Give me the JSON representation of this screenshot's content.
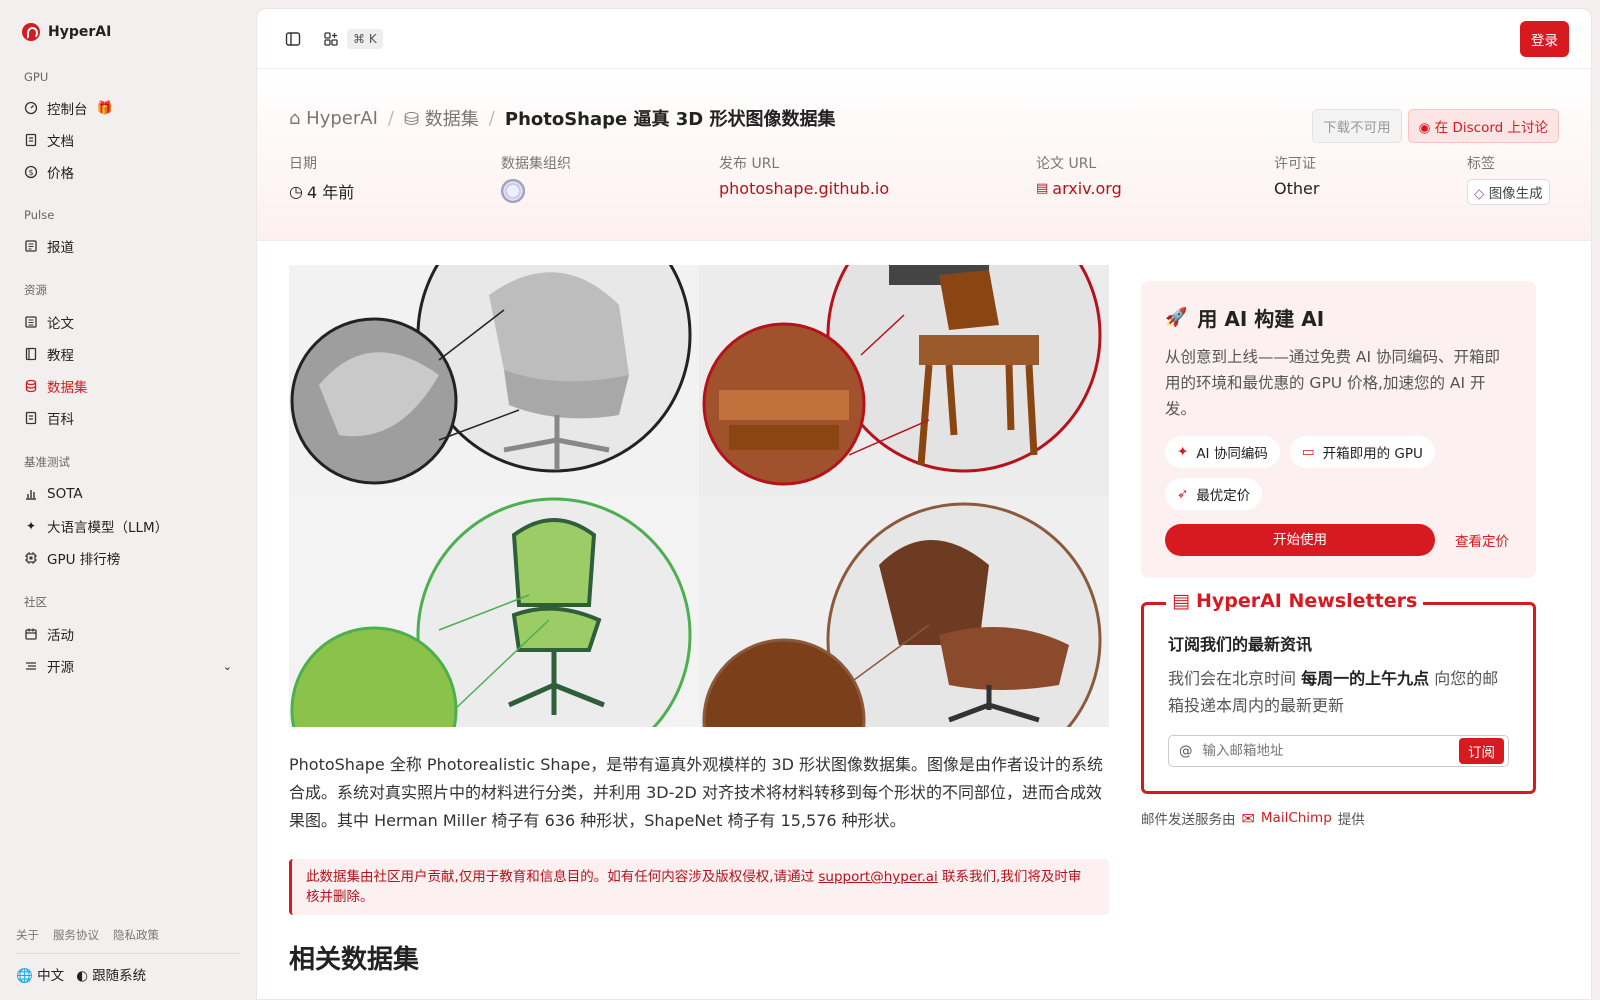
{
  "app": {
    "name": "HyperAI"
  },
  "sidebar": {
    "sections": [
      {
        "label": "GPU",
        "items": [
          {
            "label": "控制台",
            "icon": "dashboard-icon"
          },
          {
            "label": "文档",
            "icon": "doc-icon"
          },
          {
            "label": "价格",
            "icon": "dollar-icon"
          }
        ]
      },
      {
        "label": "Pulse",
        "items": [
          {
            "label": "报道",
            "icon": "news-icon"
          }
        ]
      },
      {
        "label": "资源",
        "items": [
          {
            "label": "论文",
            "icon": "paper-icon"
          },
          {
            "label": "教程",
            "icon": "book-icon"
          },
          {
            "label": "数据集",
            "icon": "database-icon"
          },
          {
            "label": "百科",
            "icon": "wiki-icon"
          }
        ]
      },
      {
        "label": "基准测试",
        "items": [
          {
            "label": "SOTA",
            "icon": "chart-icon"
          },
          {
            "label": "大语言模型（LLM）",
            "icon": "sparkle-icon"
          },
          {
            "label": "GPU 排行榜",
            "icon": "chip-icon"
          }
        ]
      },
      {
        "label": "社区",
        "items": [
          {
            "label": "活动",
            "icon": "calendar-icon"
          },
          {
            "label": "开源",
            "icon": "list-icon"
          }
        ]
      }
    ],
    "footer_links": [
      "关于",
      "服务协议",
      "隐私政策"
    ],
    "language": "中文",
    "theme": "跟随系统"
  },
  "topbar": {
    "shortcut": "⌘ K",
    "login": "登录"
  },
  "hero": {
    "breadcrumb": [
      "HyperAI",
      "数据集",
      "PhotoShape 逼真 3D 形状图像数据集"
    ],
    "download_btn": "下载不可用",
    "discord_btn": "在 Discord 上讨论",
    "meta": [
      {
        "label": "日期",
        "value": "4 年前"
      },
      {
        "label": "数据集组织",
        "value": ""
      },
      {
        "label": "发布 URL",
        "value": "photoshape.github.io"
      },
      {
        "label": "论文 URL",
        "value": "arxiv.org"
      },
      {
        "label": "许可证",
        "value": "Other"
      },
      {
        "label": "标签",
        "value": "图像生成"
      }
    ]
  },
  "content": {
    "description": "PhotoShape 全称 Photorealistic Shape，是带有逼真外观模样的 3D 形状图像数据集。图像是由作者设计的系统合成。系统对真实照片中的材料进行分类，并利用 3D-2D 对齐技术将材料转移到每个形状的不同部位，进而合成效果图。其中 Herman Miller 椅子有 636 种形状，ShapeNet 椅子有 15,576 种形状。",
    "notice_pre": "此数据集由社区用户贡献,仅用于教育和信息目的。如有任何内容涉及版权侵权,请通过 ",
    "notice_link": "support@hyper.ai",
    "notice_post": " 联系我们,我们将及时审核并删除。",
    "related_title": "相关数据集"
  },
  "promo": {
    "title": "用 AI 构建 AI",
    "text": "从创意到上线——通过免费 AI 协同编码、开箱即用的环境和最优惠的 GPU 价格,加速您的 AI 开发。",
    "pills": [
      "AI 协同编码",
      "开箱即用的 GPU",
      "最优定价"
    ],
    "start": "开始使用",
    "pricing": "查看定价"
  },
  "newsletter": {
    "title": "HyperAI Newsletters",
    "heading": "订阅我们的最新资讯",
    "text_pre": "我们会在北京时间 ",
    "text_bold": "每周一的上午九点",
    "text_post": " 向您的邮箱投递本周内的最新更新",
    "placeholder": "输入邮箱地址",
    "subscribe": "订阅",
    "mc_pre": "邮件发送服务由",
    "mc_name": "MailChimp",
    "mc_post": "提供"
  },
  "colors": {
    "accent": "#d71920",
    "green": "#4caf50",
    "brown": "#8b5a3c"
  }
}
